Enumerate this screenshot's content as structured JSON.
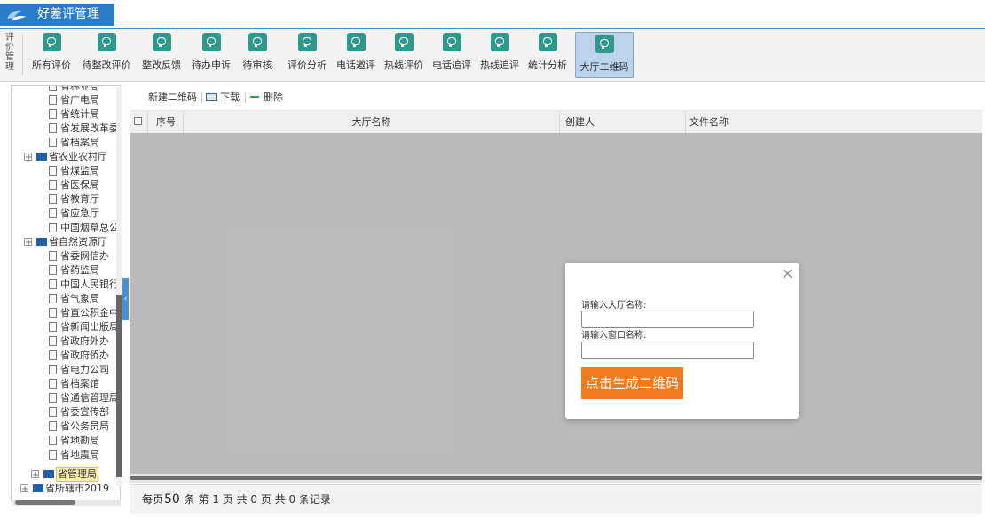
{
  "app": {
    "title": "好差评管理"
  },
  "toolbar": {
    "group_label": "评价管理",
    "buttons": [
      {
        "label": "所有评价"
      },
      {
        "label": "待整改评价"
      },
      {
        "label": "整改反馈"
      },
      {
        "label": "待办申诉"
      },
      {
        "label": "待审核"
      },
      {
        "label": "评价分析"
      },
      {
        "label": "电话邀评"
      },
      {
        "label": "热线评价"
      },
      {
        "label": "电话追评"
      },
      {
        "label": "热线追评"
      },
      {
        "label": "统计分析"
      },
      {
        "label": "大厅二维码"
      }
    ]
  },
  "tree": {
    "items": [
      {
        "label": "省林业局"
      },
      {
        "label": "省广电局"
      },
      {
        "label": "省统计局"
      },
      {
        "label": "省发展改革委"
      },
      {
        "label": "省档案局"
      },
      {
        "label": "省农业农村厅"
      },
      {
        "label": "省煤监局"
      },
      {
        "label": "省医保局"
      },
      {
        "label": "省教育厅"
      },
      {
        "label": "省应急厅"
      },
      {
        "label": "中国烟草总公"
      },
      {
        "label": "省自然资源厅"
      },
      {
        "label": "省委网信办"
      },
      {
        "label": "省药监局"
      },
      {
        "label": "中国人民银行"
      },
      {
        "label": "省气象局"
      },
      {
        "label": "省直公积金中"
      },
      {
        "label": "省新闻出版局"
      },
      {
        "label": "省政府外办"
      },
      {
        "label": "省政府侨办"
      },
      {
        "label": "省电力公司"
      },
      {
        "label": "省档案馆"
      },
      {
        "label": "省通信管理局"
      },
      {
        "label": "省委宣传部"
      },
      {
        "label": "省公务员局"
      },
      {
        "label": "省地勘局"
      },
      {
        "label": "省地震局"
      },
      {
        "label": "省管理局"
      },
      {
        "label": "省所辖市2019"
      }
    ]
  },
  "actions": {
    "new_qr": "新建二维码",
    "download": "下载",
    "delete": "删除"
  },
  "grid": {
    "columns": {
      "seq": "序号",
      "hall_name": "大厅名称",
      "creator": "创建人",
      "file_name": "文件名称"
    }
  },
  "pager": {
    "prefix": "每页",
    "page_size": "50",
    "suffix": "条 第 1 页 共 0 页 共 0 条记录"
  },
  "modal": {
    "close": "×",
    "hall_label": "请输入大厅名称:",
    "window_label": "请输入窗口名称:",
    "hall_value": "",
    "window_value": "",
    "submit": "点击生成二维码"
  },
  "colors": {
    "accent": "#2a7cc7",
    "toolbar_icon": "#2f9a8b",
    "submit": "#f07a1d",
    "delete_icon": "#2e9c48"
  }
}
